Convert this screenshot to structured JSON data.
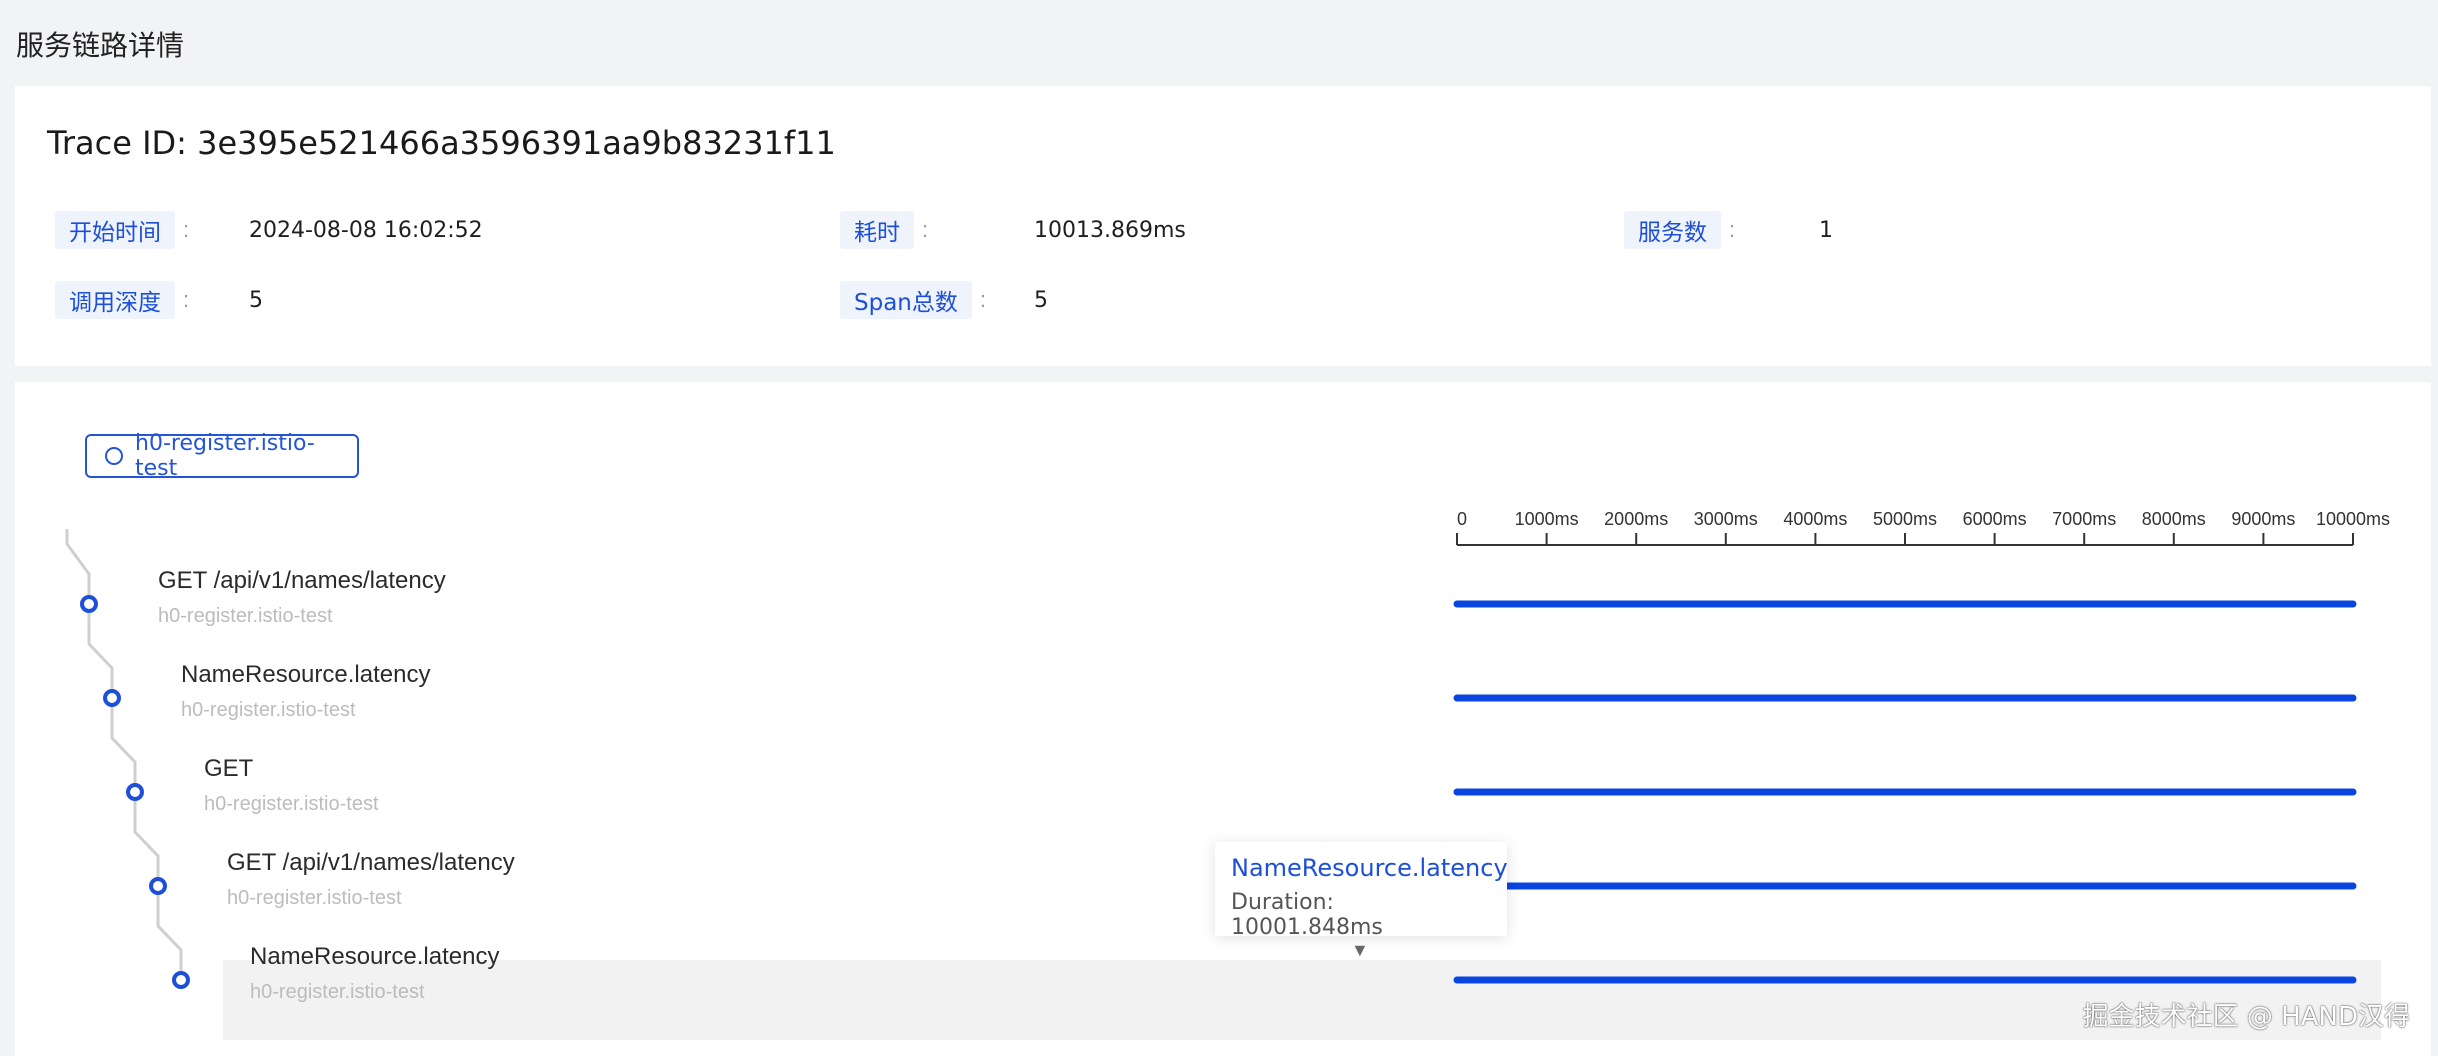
{
  "page": {
    "title": "服务链路详情"
  },
  "trace": {
    "id_text": "Trace ID: 3e395e521466a3596391aa9b83231f11",
    "meta": {
      "start_label": "开始时间",
      "start_value": "2024-08-08 16:02:52",
      "duration_label": "耗时",
      "duration_value": "10013.869ms",
      "services_label": "服务数",
      "services_value": "1",
      "depth_label": "调用深度",
      "depth_value": "5",
      "spans_label": "Span总数",
      "spans_value": "5"
    },
    "colon": ":"
  },
  "service_tag": {
    "label": "h0-register.istio-test"
  },
  "timeline": {
    "min": 0,
    "max": 10000,
    "ticks": [
      "0",
      "1000ms",
      "2000ms",
      "3000ms",
      "4000ms",
      "5000ms",
      "6000ms",
      "7000ms",
      "8000ms",
      "9000ms",
      "10000ms"
    ],
    "tick_values": [
      0,
      1000,
      2000,
      3000,
      4000,
      5000,
      6000,
      7000,
      8000,
      9000,
      10000
    ],
    "bar_color": "#0b45e0"
  },
  "spans": [
    {
      "name": "GET /api/v1/names/latency",
      "service": "h0-register.istio-test",
      "start": 0,
      "end": 10000,
      "depth": 0
    },
    {
      "name": "NameResource.latency",
      "service": "h0-register.istio-test",
      "start": 0,
      "end": 10000,
      "depth": 1
    },
    {
      "name": "GET",
      "service": "h0-register.istio-test",
      "start": 0,
      "end": 10000,
      "depth": 2
    },
    {
      "name": "GET /api/v1/names/latency",
      "service": "h0-register.istio-test",
      "start": 0,
      "end": 10000,
      "depth": 3
    },
    {
      "name": "NameResource.latency",
      "service": "h0-register.istio-test",
      "start": 0,
      "end": 10000,
      "depth": 4
    }
  ],
  "tooltip": {
    "title": "NameResource.latency",
    "duration": "Duration: 10001.848ms",
    "arrow": "▼"
  },
  "watermark": "掘金技术社区 @ HAND汉得"
}
